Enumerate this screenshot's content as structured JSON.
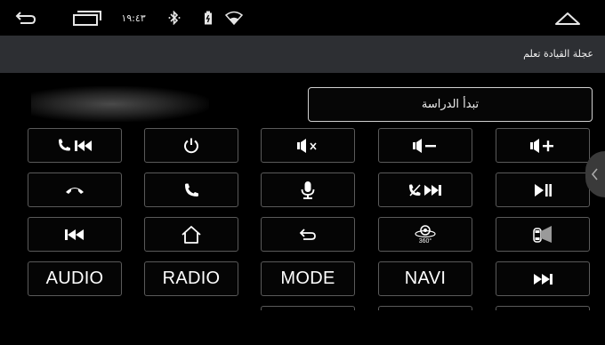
{
  "status_bar": {
    "time": "١٩:٤٣",
    "icons": [
      "back-icon",
      "recent-apps-icon",
      "bluetooth-icon",
      "battery-icon",
      "wifi-icon",
      "home-icon"
    ]
  },
  "header": {
    "title": "عجلة القيادة تعلم"
  },
  "start_button": {
    "label": "تبدأ الدراسة"
  },
  "keys": [
    {
      "label": "",
      "icon": "call-previous-icon"
    },
    {
      "label": "",
      "icon": "power-icon"
    },
    {
      "label": "",
      "icon": "mute-icon"
    },
    {
      "label": "",
      "icon": "volume-down-icon"
    },
    {
      "label": "",
      "icon": "volume-up-icon"
    },
    {
      "label": "",
      "icon": "hang-up-icon"
    },
    {
      "label": "",
      "icon": "answer-call-icon"
    },
    {
      "label": "",
      "icon": "microphone-icon"
    },
    {
      "label": "",
      "icon": "reject-next-icon"
    },
    {
      "label": "",
      "icon": "play-pause-icon"
    },
    {
      "label": "",
      "icon": "previous-track-icon"
    },
    {
      "label": "",
      "icon": "home-icon"
    },
    {
      "label": "",
      "icon": "return-icon"
    },
    {
      "label": "360°",
      "icon": "camera-360-icon"
    },
    {
      "label": "",
      "icon": "car-door-icon"
    },
    {
      "label": "AUDIO",
      "icon": ""
    },
    {
      "label": "RADIO",
      "icon": ""
    },
    {
      "label": "MODE",
      "icon": ""
    },
    {
      "label": "NAVI",
      "icon": ""
    },
    {
      "label": "",
      "icon": "next-track-icon"
    }
  ],
  "colors": {
    "background": "#000000",
    "header": "#2d2f33",
    "key_border": "#5a5a5a"
  }
}
